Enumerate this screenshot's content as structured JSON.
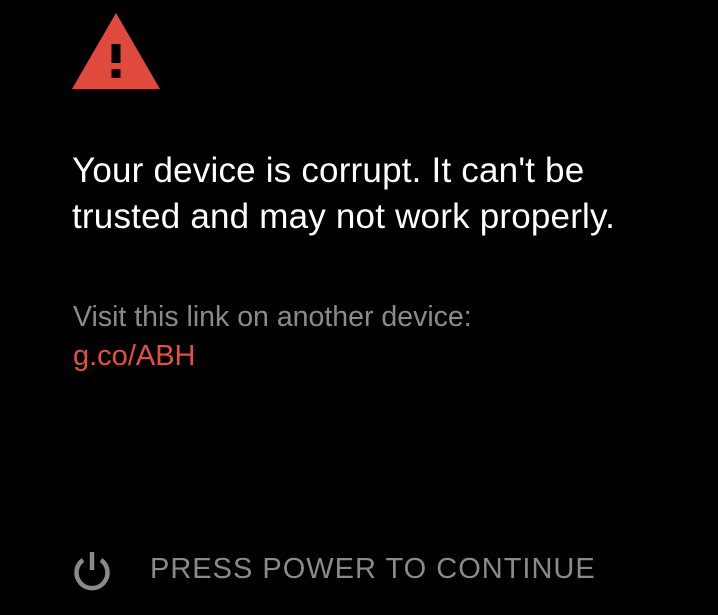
{
  "colors": {
    "background": "#000000",
    "warning": "#e04a3d",
    "headline": "#ffffff",
    "secondary_text": "#8a8a8a",
    "link": "#e25043"
  },
  "icons": {
    "warning": "warning-triangle-icon",
    "power": "power-icon"
  },
  "message": {
    "headline": "Your device is corrupt. It can't be trusted and may not work properly.",
    "visit_text": "Visit this link on another device:",
    "link_text": "g.co/ABH"
  },
  "footer": {
    "continue_label": "PRESS POWER TO CONTINUE"
  }
}
